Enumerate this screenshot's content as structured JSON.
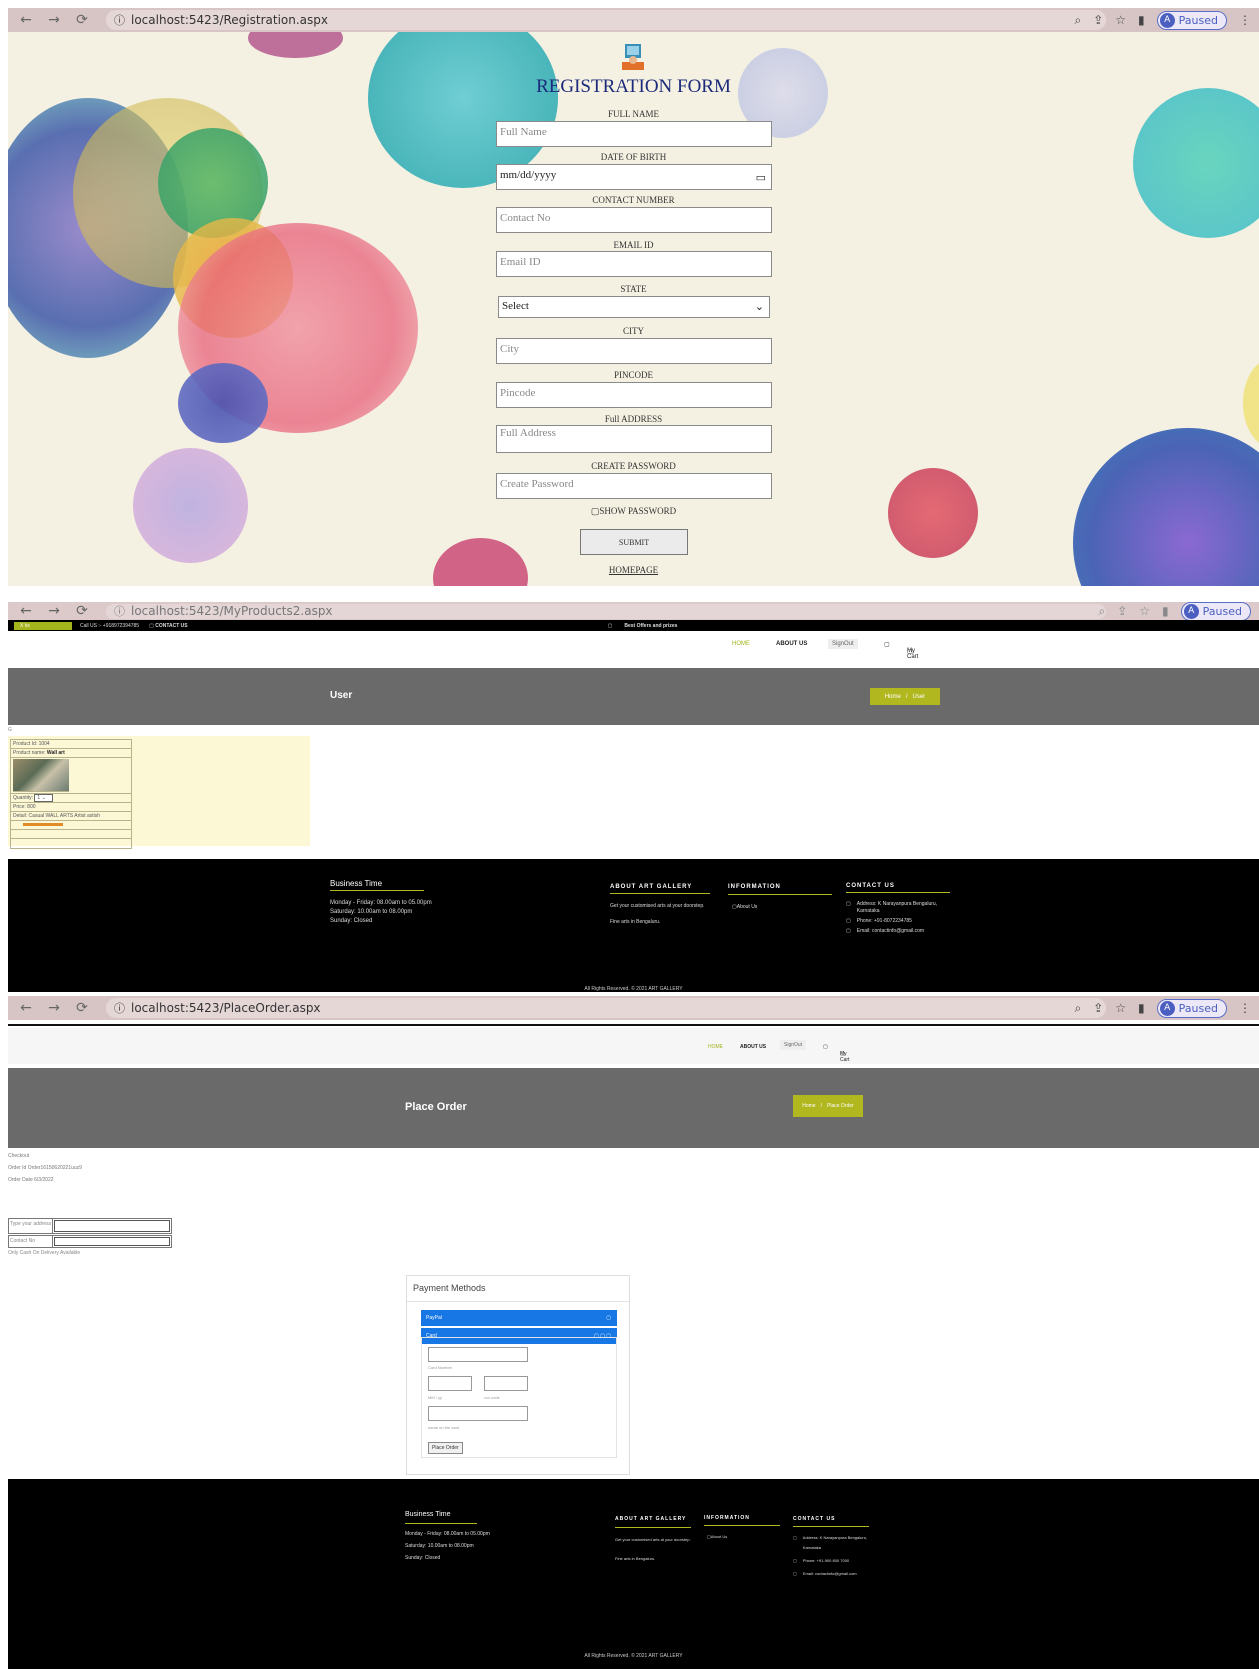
{
  "screens": {
    "registration": {
      "browser": {
        "url": "localhost:5423/Registration.aspx",
        "profile_initial": "A",
        "profile_status": "Paused"
      },
      "title": "REGISTRATION FORM",
      "fields": {
        "full_name": {
          "label": "FULL NAME",
          "placeholder": "Full Name"
        },
        "dob": {
          "label": "DATE OF BIRTH",
          "placeholder": "mm/dd/yyyy"
        },
        "contact": {
          "label": "CONTACT NUMBER",
          "placeholder": "Contact No"
        },
        "email": {
          "label": "EMAIL ID",
          "placeholder": "Email ID"
        },
        "state": {
          "label": "STATE",
          "value": "Select"
        },
        "city": {
          "label": "CITY",
          "placeholder": "City"
        },
        "pincode": {
          "label": "PINCODE",
          "placeholder": "Pincode"
        },
        "address": {
          "label": "Full ADDRESS",
          "placeholder": "Full Address"
        },
        "password": {
          "label": "CREATE PASSWORD",
          "placeholder": "Create Password"
        }
      },
      "show_password": "SHOW PASSWORD",
      "submit": "SUBMIT",
      "homepage": "HOMEPAGE"
    },
    "my_products": {
      "browser": {
        "url": "localhost:5423/MyProducts2.aspx",
        "profile_initial": "A",
        "profile_status": "Paused"
      },
      "topbar": {
        "language": "X ks",
        "call": "Call US :- +918972394785",
        "contact": "CONTACT US",
        "offer": "Best Offers and prizes"
      },
      "nav": {
        "home": "HOME",
        "about": "ABOUT US",
        "signout": "SignOut",
        "cart": "My Cart"
      },
      "hero_title": "User",
      "breadcrumb": {
        "home": "Home",
        "sep": "/",
        "current": "User"
      },
      "stray": "G",
      "product": {
        "id": "Product Id: 1004",
        "name_label": "Product name:",
        "name": "Wall art",
        "quantity_label": "Quantity:",
        "quantity": "1",
        "price": "Price: 800",
        "detail": "Detail: Casual WALL ARTS Artist astish"
      },
      "footer": {
        "business_title": "Business Time",
        "hours": [
          "Monday - Friday: 08.00am to 05.00pm",
          "Saturday: 10.00am to 08.00pm",
          "Sunday: Closed"
        ],
        "about_title": "ABOUT ART GALLERY",
        "about_text": "Get your customised arts at your doorstep.",
        "about_text2": "Fine arts in Bengaluru.",
        "info_title": "INFORMATION",
        "info_link": "About Us",
        "contact_title": "CONTACT US",
        "address": "Address: K Narayanpura Bengaluru, Karnataka",
        "phone": "Phone: +91-8072234785",
        "email": "Email: contactinfo@gmail.com",
        "copyright": "All Rights Reserved. © 2021 ART GALLERY"
      }
    },
    "place_order": {
      "browser": {
        "url": "localhost:5423/PlaceOrder.aspx",
        "profile_initial": "A",
        "profile_status": "Paused"
      },
      "nav": {
        "home": "HOME",
        "about": "ABOUT US",
        "signout": "SignOut",
        "cart": "My Cart"
      },
      "hero_title": "Place Order",
      "breadcrumb": {
        "home": "Home",
        "sep": "/",
        "current": "Place Order"
      },
      "checkout": "Checkout",
      "order_id": "Order Id     Order16150620221uuz9",
      "order_date": "Order Date 6/3/2022",
      "address_label": "Type your address",
      "contact_label": "Contact No",
      "cod_note": "Only Cash On Delivery Available",
      "payment": {
        "title": "Payment Methods",
        "paypal": "PayPal",
        "card": "Card",
        "card_number": "Card Number",
        "expiry": "MM / yy",
        "cvv": "cvv code",
        "name": "name on the card",
        "button": "Place Order"
      },
      "footer": {
        "business_title": "Business Time",
        "hours": [
          "Monday - Friday: 08.00am to 05.00pm",
          "Saturday: 10.00am to 08.00pm",
          "Sunday: Closed"
        ],
        "about_title": "ABOUT ART GALLERY",
        "about_text": "Get your customised arts at your doorstep.",
        "about_text2": "Fine arts in Bengaluru.",
        "info_title": "INFORMATION",
        "info_link": "About Us",
        "contact_title": "CONTACT US",
        "address": "Address: K Narayanpura Bengaluru, Karnataka",
        "phone": "Phone: +91-900 800 7000",
        "email": "Email: contactinfo@gmail.com",
        "copyright": "All Rights Reserved. © 2021 ART GALLERY"
      }
    }
  },
  "colors": {
    "accent": "#b1b71f",
    "hero": "#6a6a6a",
    "payment_blue": "#1677e5",
    "title_blue": "#1b2a7a"
  }
}
